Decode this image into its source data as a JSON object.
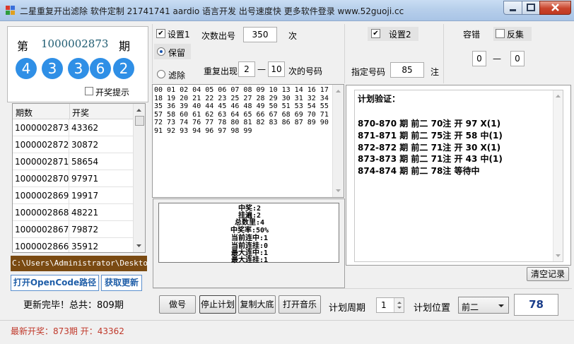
{
  "window": {
    "title": "二星重复开出滤除 软件定制 21741741 aardio 语言开发 出号速度快 更多软件登录 www.52guoji.cc"
  },
  "colors": {
    "ball": "#2f8fe6",
    "accent_text": "#1c5a70",
    "status_red": "#c0392b"
  },
  "current": {
    "prefix": "第",
    "period": "1000002873",
    "suffix": "期",
    "balls": [
      "4",
      "3",
      "3",
      "6",
      "2"
    ],
    "notify_label": "开奖提示"
  },
  "history": {
    "headers": [
      "期数",
      "开奖"
    ],
    "rows": [
      [
        "1000002873",
        "43362"
      ],
      [
        "1000002872",
        "30872"
      ],
      [
        "1000002871",
        "58654"
      ],
      [
        "1000002870",
        "97971"
      ],
      [
        "1000002869",
        "19917"
      ],
      [
        "1000002868",
        "48221"
      ],
      [
        "1000002867",
        "79872"
      ],
      [
        "1000002866",
        "35912"
      ]
    ]
  },
  "path": "C:\\Users\\Administrator\\Desktop\\k",
  "buttons": {
    "open_path": "打开OpenCode路径",
    "fetch_update": "获取更新",
    "make": "做号",
    "stop_plan": "停止计划",
    "copy_base": "复制大底",
    "open_music": "打开音乐",
    "clear_log": "清空记录"
  },
  "status_line": "更新完毕！总共：809期",
  "settings1": {
    "label": "设置1",
    "count_label": "次数出号",
    "count_value": "350",
    "count_unit": "次",
    "keep_label": "保留",
    "filter_label": "滤除",
    "repeat_label": "重复出现",
    "repeat_from": "2",
    "dash": "—",
    "repeat_to": "10",
    "repeat_suffix": "次的号码"
  },
  "settings2": {
    "label": "设置2",
    "fixed_label": "指定号码",
    "fixed_value": "85",
    "fixed_unit": "注"
  },
  "tolerance": {
    "label": "容错",
    "reverse_label": "反集",
    "from": "0",
    "dash": "—",
    "to": "0"
  },
  "numbers_text": "00 01 02 04 05 06 07 08 09 10 13 14 16 17\n18 19 20 21 22 23 25 27 28 29 30 31 32 34\n35 36 39 40 44 45 46 48 49 50 51 53 54 55\n57 58 60 61 62 63 64 65 66 67 68 69 70 71\n72 73 74 76 77 78 80 81 82 83 86 87 89 90\n91 92 93 94 96 97 98 99",
  "stats": [
    "中奖:2",
    "挂遍:2",
    "总数里:4",
    "中奖率:50%",
    "当前连中:1",
    "当前连挂:0",
    "最大连中:1",
    "最大连挂:1"
  ],
  "verify": {
    "title": "计划验证：",
    "lines": [
      "870-870 期 前二 70注 开 97  X(1)",
      "871-871 期 前二 75注 开 58 中(1)",
      "872-872 期 前二 71注 开 30  X(1)",
      "873-873 期 前二 71注 开 43 中(1)",
      "874-874 期 前二 78注 等待中"
    ]
  },
  "plan": {
    "cycle_label": "计划周期",
    "cycle_value": "1",
    "position_label": "计划位置",
    "position_value": "前二",
    "count_display": "78"
  },
  "footer": "最新开奖：873期 开：43362"
}
